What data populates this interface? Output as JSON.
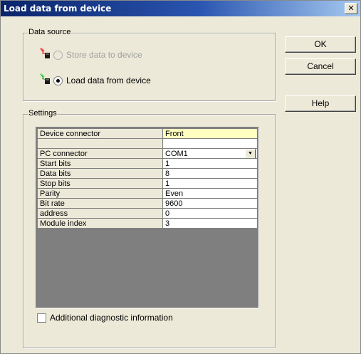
{
  "window": {
    "title": "Load data from device",
    "close_glyph": "✕"
  },
  "buttons": {
    "ok": "OK",
    "cancel": "Cancel",
    "help": "Help"
  },
  "data_source": {
    "label": "Data source",
    "store_option": {
      "label": "Store data to device",
      "enabled": false,
      "selected": false,
      "icon": "upload-device-icon"
    },
    "load_option": {
      "label": "Load data from device",
      "enabled": true,
      "selected": true,
      "icon": "download-device-icon"
    }
  },
  "settings": {
    "label": "Settings",
    "rows": [
      {
        "key": "Device connector",
        "value": "Front",
        "highlighted": true
      },
      {
        "key": "",
        "value": ""
      },
      {
        "key": "PC connector",
        "value": "COM1",
        "dropdown": true
      },
      {
        "key": "Start bits",
        "value": "1"
      },
      {
        "key": "Data bits",
        "value": "8"
      },
      {
        "key": "Stop bits",
        "value": "1"
      },
      {
        "key": "Parity",
        "value": "Even"
      },
      {
        "key": "Bit rate",
        "value": "9600"
      },
      {
        "key": "address",
        "value": "0"
      },
      {
        "key": "Module index",
        "value": "3"
      }
    ],
    "diagnostic_checkbox": {
      "label": "Additional diagnostic information",
      "checked": false
    }
  },
  "colors": {
    "dialog_bg": "#ece9d8",
    "title_start": "#0a246a",
    "title_end": "#a6caf0",
    "highlight_cell": "#ffffc0",
    "grid_empty": "#7f7f7f"
  }
}
